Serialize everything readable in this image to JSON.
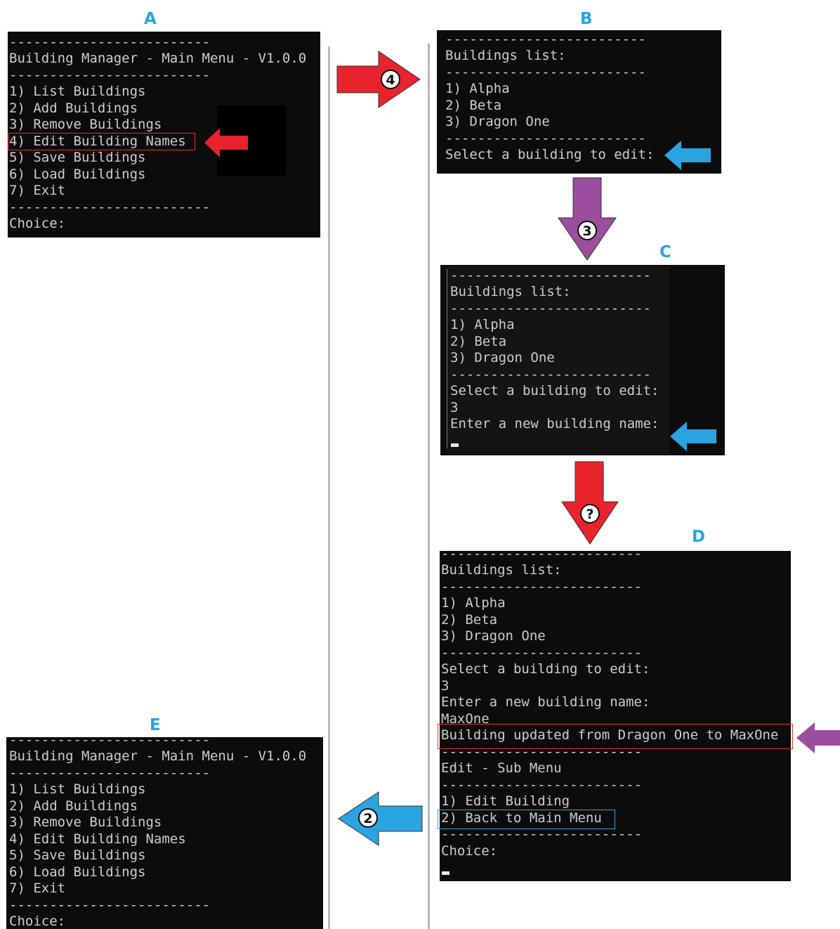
{
  "panels": {
    "A": {
      "letter": "A",
      "lines": [
        "-------------------------",
        "Building Manager - Main Menu - V1.0.0",
        "-------------------------",
        "1) List Buildings",
        "2) Add Buildings",
        "3) Remove Buildings",
        "4) Edit Building Names",
        "5) Save Buildings",
        "6) Load Buildings",
        "7) Exit",
        "-------------------------",
        "Choice:"
      ]
    },
    "B": {
      "letter": "B",
      "lines": [
        "-------------------------",
        "Buildings list:",
        "-------------------------",
        "1) Alpha",
        "2) Beta",
        "3) Dragon One",
        "-------------------------",
        "Select a building to edit:"
      ]
    },
    "C": {
      "letter": "C",
      "lines": [
        "-------------------------",
        "Buildings list:",
        "-------------------------",
        "1) Alpha",
        "2) Beta",
        "3) Dragon One",
        "-------------------------",
        "Select a building to edit:",
        "3",
        "Enter a new building name:"
      ]
    },
    "D": {
      "letter": "D",
      "lines": [
        "-------------------------",
        "Buildings list:",
        "-------------------------",
        "1) Alpha",
        "2) Beta",
        "3) Dragon One",
        "-------------------------",
        "Select a building to edit:",
        "3",
        "Enter a new building name:",
        "MaxOne",
        "Building updated from Dragon One to MaxOne",
        "-------------------------",
        "Edit - Sub Menu",
        "-------------------------",
        "1) Edit Building",
        "2) Back to Main Menu",
        "-------------------------",
        "Choice:"
      ]
    },
    "E": {
      "letter": "E",
      "lines": [
        "-------------------------",
        "Building Manager - Main Menu - V1.0.0",
        "-------------------------",
        "1) List Buildings",
        "2) Add Buildings",
        "3) Remove Buildings",
        "4) Edit Building Names",
        "5) Save Buildings",
        "6) Load Buildings",
        "7) Exit",
        "-------------------------",
        "Choice:"
      ]
    }
  },
  "arrows": {
    "a_to_b": {
      "number": "4",
      "color": "#e8232b"
    },
    "b_to_c": {
      "number": "3",
      "color": "#9b4d9e"
    },
    "c_to_d": {
      "number": "?",
      "color": "#e8232b"
    },
    "d_to_e": {
      "number": "2",
      "color": "#2aa4e0"
    },
    "pointer_a": {
      "color": "#e8232b"
    },
    "pointer_b": {
      "color": "#2aa4e0"
    },
    "pointer_c": {
      "color": "#2aa4e0"
    },
    "pointer_d": {
      "color": "#9b4d9e"
    }
  },
  "colors": {
    "terminal_bg": "#0c0c0c",
    "terminal_text": "#cccccc",
    "letter": "#2aa4e0",
    "highlight_red": "#e0332c",
    "highlight_blue": "#2aa4e0"
  }
}
